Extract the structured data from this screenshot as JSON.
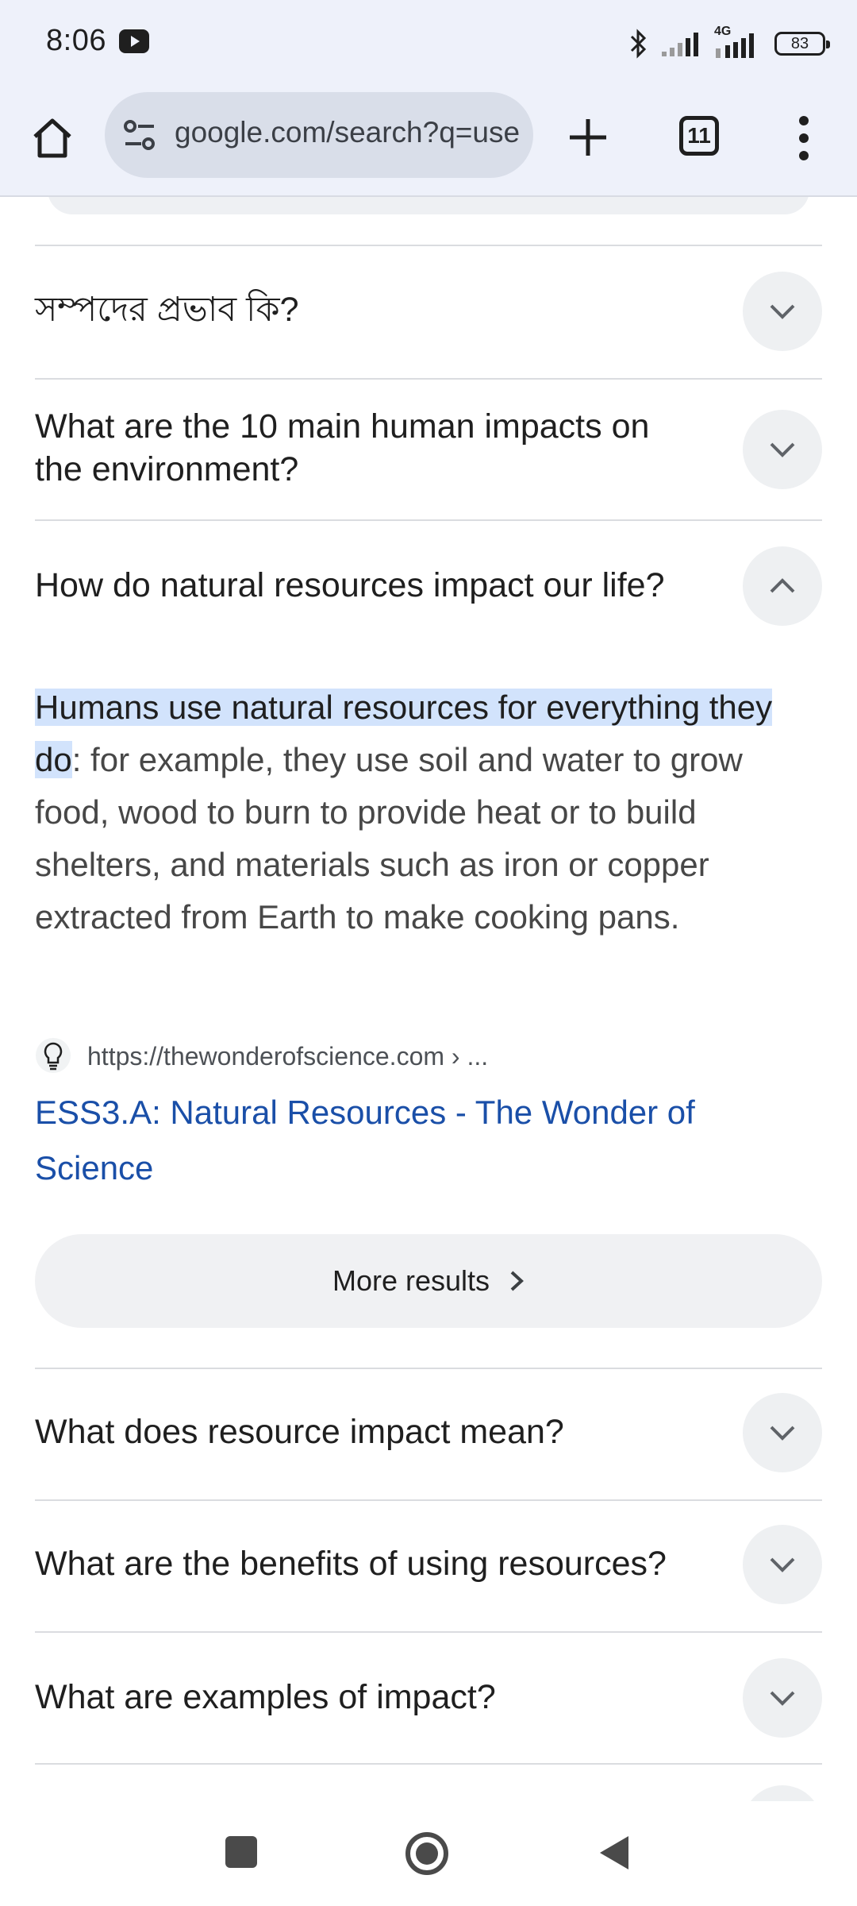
{
  "status": {
    "time": "8:06",
    "network": "4G",
    "battery": "83"
  },
  "toolbar": {
    "url": "google.com/search?q=use",
    "tab_count": "11"
  },
  "faq": [
    {
      "question": "সম্পদের প্রভাব কি?",
      "expanded": false
    },
    {
      "question": "What are the 10 main human impacts on the environment?",
      "expanded": false
    },
    {
      "question": "How do natural resources impact our life?",
      "expanded": true
    },
    {
      "question": "What does resource impact mean?",
      "expanded": false
    },
    {
      "question": "What are the benefits of using resources?",
      "expanded": false
    },
    {
      "question": "What are examples of impact?",
      "expanded": false
    }
  ],
  "answer": {
    "highlight": "Humans use natural resources for everything they do",
    "rest": ": for example, they use soil and water to grow food, wood to burn to provide heat or to build shelters, and materials such as iron or copper extracted from Earth to make cooking pans.",
    "source_url": "https://thewonderofscience.com › ...",
    "source_title": "ESS3.A: Natural Resources - The Wonder of Science"
  },
  "more_results_label": "More results",
  "colors": {
    "highlight": "#d2e3fc",
    "link": "#1a4fa8",
    "chrome_bg": "#eef1fa"
  },
  "icons": [
    "youtube-icon",
    "bluetooth-icon",
    "signal-icon",
    "battery-icon",
    "home-icon",
    "tune-icon",
    "plus-icon",
    "tabs-icon",
    "more-vert-icon",
    "chevron-down-icon",
    "chevron-up-icon",
    "chevron-right-icon",
    "lightbulb-icon",
    "nav-recents-icon",
    "nav-home-icon",
    "nav-back-icon"
  ]
}
